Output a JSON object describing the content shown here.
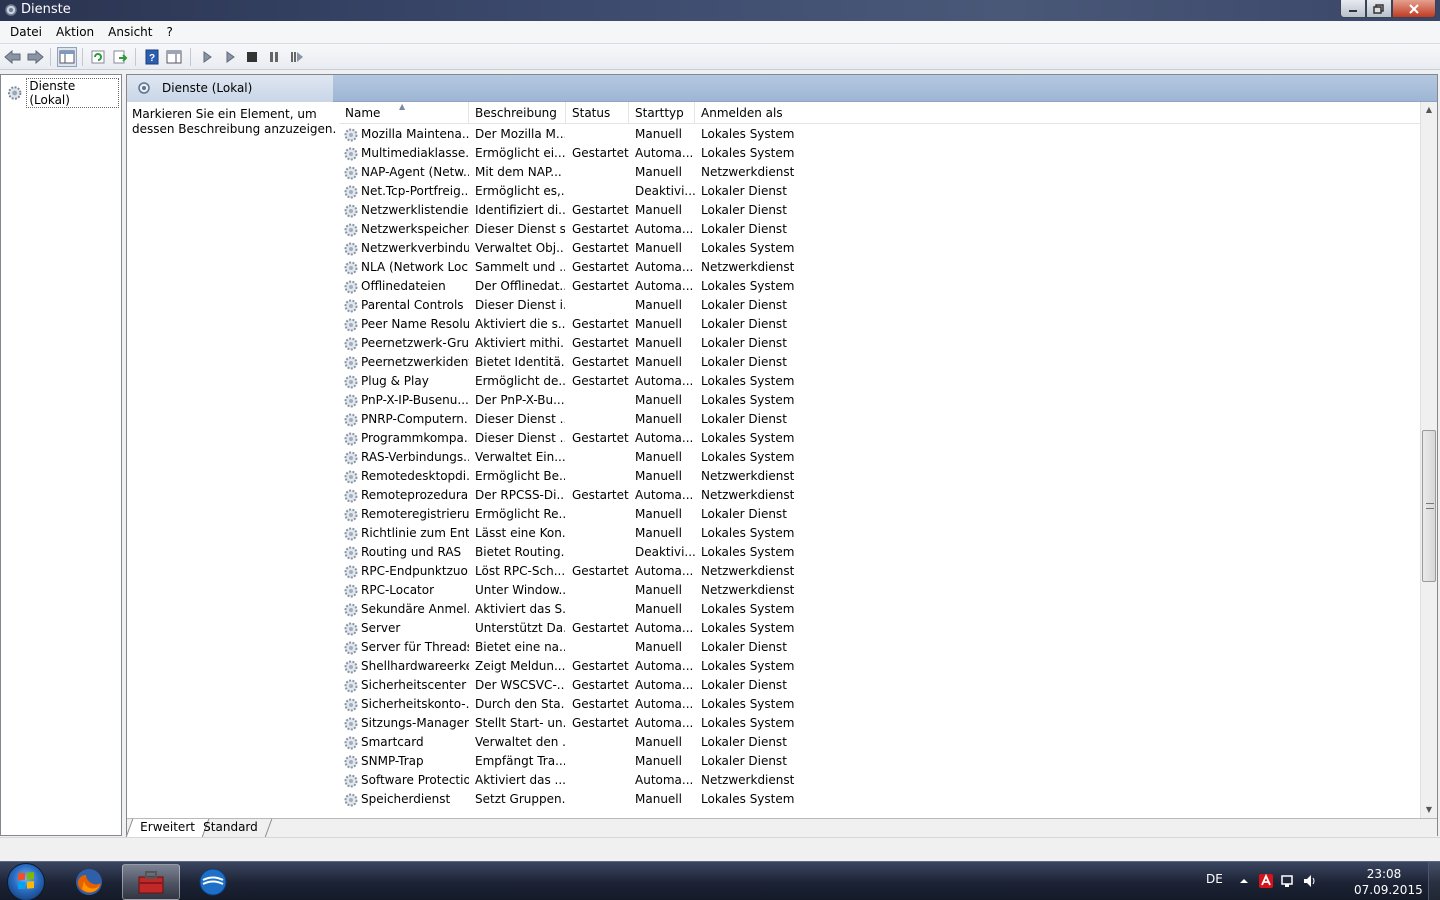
{
  "window": {
    "title": "Dienste",
    "min_icon": "minimize-icon",
    "max_icon": "maximize-icon",
    "close_icon": "close-icon"
  },
  "menu": [
    "Datei",
    "Aktion",
    "Ansicht",
    "?"
  ],
  "toolbar_icons": [
    "back-arrow-icon",
    "forward-arrow-icon",
    "show-console-tree-icon",
    "refresh-icon",
    "export-list-icon",
    "help-icon",
    "properties-icon",
    "start-service-icon",
    "start-service-alt-icon",
    "stop-service-icon",
    "pause-service-icon",
    "restart-service-icon"
  ],
  "tree": {
    "root_label": "Dienste (Lokal)"
  },
  "pane": {
    "header_title": "Dienste (Lokal)",
    "description": "Markieren Sie ein Element, um dessen Beschreibung anzuzeigen."
  },
  "columns": {
    "name": "Name",
    "desc": "Beschreibung",
    "status": "Status",
    "start": "Starttyp",
    "logon": "Anmelden als"
  },
  "services": [
    {
      "name": "Mozilla Maintena...",
      "desc": "Der Mozilla M...",
      "status": "",
      "start": "Manuell",
      "logon": "Lokales System"
    },
    {
      "name": "Multimediaklasse...",
      "desc": "Ermöglicht ei...",
      "status": "Gestartet",
      "start": "Automa...",
      "logon": "Lokales System"
    },
    {
      "name": "NAP-Agent (Netw...",
      "desc": "Mit dem NAP...",
      "status": "",
      "start": "Manuell",
      "logon": "Netzwerkdienst"
    },
    {
      "name": "Net.Tcp-Portfreig...",
      "desc": "Ermöglicht es,...",
      "status": "",
      "start": "Deaktivi...",
      "logon": "Lokaler Dienst"
    },
    {
      "name": "Netzwerklistendie...",
      "desc": "Identifiziert di...",
      "status": "Gestartet",
      "start": "Manuell",
      "logon": "Lokaler Dienst"
    },
    {
      "name": "Netzwerkspeicher...",
      "desc": "Dieser Dienst s...",
      "status": "Gestartet",
      "start": "Automa...",
      "logon": "Lokaler Dienst"
    },
    {
      "name": "Netzwerkverbindu...",
      "desc": "Verwaltet Obj...",
      "status": "Gestartet",
      "start": "Manuell",
      "logon": "Lokales System"
    },
    {
      "name": "NLA (Network Loc...",
      "desc": "Sammelt und ...",
      "status": "Gestartet",
      "start": "Automa...",
      "logon": "Netzwerkdienst"
    },
    {
      "name": "Offlinedateien",
      "desc": "Der Offlinedat...",
      "status": "Gestartet",
      "start": "Automa...",
      "logon": "Lokales System"
    },
    {
      "name": "Parental Controls",
      "desc": "Dieser Dienst i...",
      "status": "",
      "start": "Manuell",
      "logon": "Lokaler Dienst"
    },
    {
      "name": "Peer Name Resolu...",
      "desc": "Aktiviert die s...",
      "status": "Gestartet",
      "start": "Manuell",
      "logon": "Lokaler Dienst"
    },
    {
      "name": "Peernetzwerk-Gru...",
      "desc": "Aktiviert mithi...",
      "status": "Gestartet",
      "start": "Manuell",
      "logon": "Lokaler Dienst"
    },
    {
      "name": "Peernetzwerkident...",
      "desc": "Bietet Identitä...",
      "status": "Gestartet",
      "start": "Manuell",
      "logon": "Lokaler Dienst"
    },
    {
      "name": "Plug & Play",
      "desc": "Ermöglicht de...",
      "status": "Gestartet",
      "start": "Automa...",
      "logon": "Lokales System"
    },
    {
      "name": "PnP-X-IP-Busenu...",
      "desc": "Der PnP-X-Bu...",
      "status": "",
      "start": "Manuell",
      "logon": "Lokales System"
    },
    {
      "name": "PNRP-Computern...",
      "desc": "Dieser Dienst ...",
      "status": "",
      "start": "Manuell",
      "logon": "Lokaler Dienst"
    },
    {
      "name": "Programmkompa...",
      "desc": "Dieser Dienst ...",
      "status": "Gestartet",
      "start": "Automa...",
      "logon": "Lokales System"
    },
    {
      "name": "RAS-Verbindungs...",
      "desc": "Verwaltet Ein...",
      "status": "",
      "start": "Manuell",
      "logon": "Lokales System"
    },
    {
      "name": "Remotedesktopdi...",
      "desc": "Ermöglicht Be...",
      "status": "",
      "start": "Manuell",
      "logon": "Netzwerkdienst"
    },
    {
      "name": "Remoteprozedura...",
      "desc": "Der RPCSS-Di...",
      "status": "Gestartet",
      "start": "Automa...",
      "logon": "Netzwerkdienst"
    },
    {
      "name": "Remoteregistrieru...",
      "desc": "Ermöglicht Re...",
      "status": "",
      "start": "Manuell",
      "logon": "Lokaler Dienst"
    },
    {
      "name": "Richtlinie zum Ent...",
      "desc": "Lässt eine Kon...",
      "status": "",
      "start": "Manuell",
      "logon": "Lokales System"
    },
    {
      "name": "Routing und RAS",
      "desc": "Bietet Routing...",
      "status": "",
      "start": "Deaktivi...",
      "logon": "Lokales System"
    },
    {
      "name": "RPC-Endpunktzuo...",
      "desc": "Löst RPC-Sch...",
      "status": "Gestartet",
      "start": "Automa...",
      "logon": "Netzwerkdienst"
    },
    {
      "name": "RPC-Locator",
      "desc": "Unter Window...",
      "status": "",
      "start": "Manuell",
      "logon": "Netzwerkdienst"
    },
    {
      "name": "Sekundäre Anmel...",
      "desc": "Aktiviert das S...",
      "status": "",
      "start": "Manuell",
      "logon": "Lokales System"
    },
    {
      "name": "Server",
      "desc": "Unterstützt Da...",
      "status": "Gestartet",
      "start": "Automa...",
      "logon": "Lokales System"
    },
    {
      "name": "Server für Threads...",
      "desc": "Bietet eine na...",
      "status": "",
      "start": "Manuell",
      "logon": "Lokaler Dienst"
    },
    {
      "name": "Shellhardwareerke...",
      "desc": "Zeigt Meldun...",
      "status": "Gestartet",
      "start": "Automa...",
      "logon": "Lokales System"
    },
    {
      "name": "Sicherheitscenter",
      "desc": "Der WSCSVC-...",
      "status": "Gestartet",
      "start": "Automa...",
      "logon": "Lokaler Dienst"
    },
    {
      "name": "Sicherheitskonto-...",
      "desc": "Durch den Sta...",
      "status": "Gestartet",
      "start": "Automa...",
      "logon": "Lokales System"
    },
    {
      "name": "Sitzungs-Manager...",
      "desc": "Stellt Start- un...",
      "status": "Gestartet",
      "start": "Automa...",
      "logon": "Lokales System"
    },
    {
      "name": "Smartcard",
      "desc": "Verwaltet den ...",
      "status": "",
      "start": "Manuell",
      "logon": "Lokaler Dienst"
    },
    {
      "name": "SNMP-Trap",
      "desc": "Empfängt Tra...",
      "status": "",
      "start": "Manuell",
      "logon": "Lokaler Dienst"
    },
    {
      "name": "Software Protection",
      "desc": "Aktiviert das ...",
      "status": "",
      "start": "Automa...",
      "logon": "Netzwerkdienst"
    },
    {
      "name": "Speicherdienst",
      "desc": "Setzt Gruppen...",
      "status": "",
      "start": "Manuell",
      "logon": "Lokales System"
    }
  ],
  "bottom_tabs": [
    "Erweitert",
    "Standard"
  ],
  "taskbar": {
    "apps": [
      "firefox-icon",
      "services-toolbox-icon",
      "network-app-icon"
    ],
    "language": "DE",
    "time": "23:08",
    "date": "07.09.2015"
  }
}
